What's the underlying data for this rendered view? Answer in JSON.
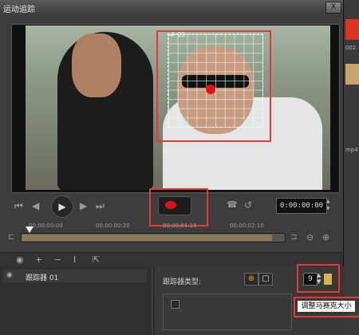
{
  "window": {
    "title": "运动追踪",
    "close_label": "X"
  },
  "video": {
    "tracker_label": "# 01"
  },
  "controls": {
    "timecode": "0:00:00:00"
  },
  "timeline": {
    "ticks": [
      "00:00:00:00",
      "00:00:00:20",
      "00:00:01:15",
      "00:00:02:10"
    ],
    "progress": 0.95
  },
  "tracks": {
    "items": [
      {
        "label": "跟踪器 01"
      }
    ]
  },
  "properties": {
    "tracker_type_label": "跟踪器类型:",
    "mosaic_size_value": "9",
    "tooltip": "调整马赛克大小"
  },
  "right_strip": {
    "labels": [
      "002.",
      "mp4"
    ]
  },
  "colors": {
    "highlight_red": "#e23a3a",
    "record_red": "#e0101a"
  }
}
